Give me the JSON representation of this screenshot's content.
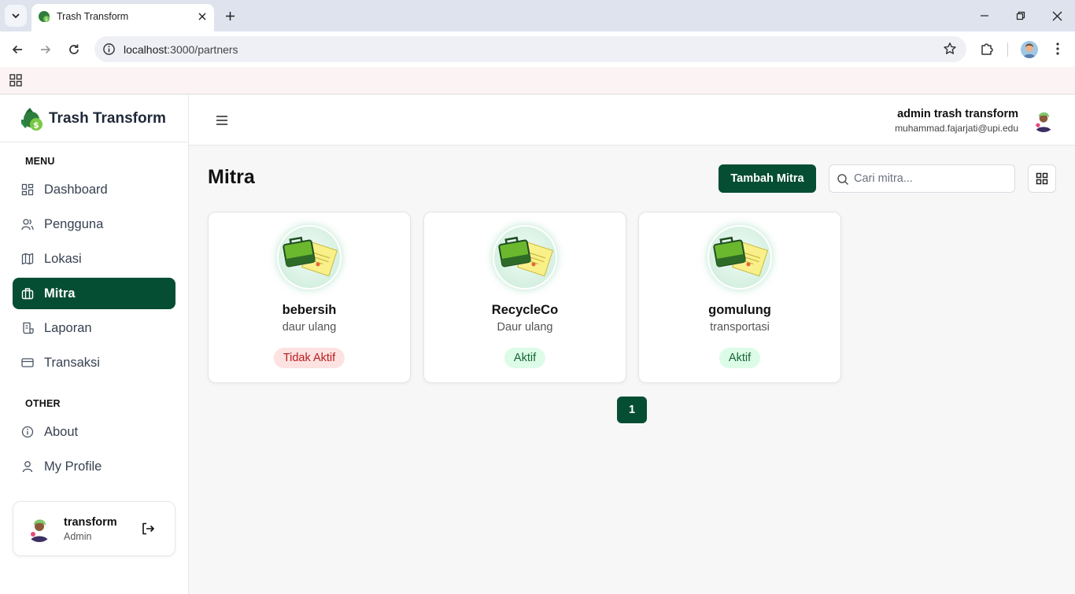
{
  "browser": {
    "tab_title": "Trash Transform",
    "url_host": "localhost",
    "url_path": ":3000/partners"
  },
  "sidebar": {
    "brand": "Trash Transform",
    "menu_label": "MENU",
    "items": [
      {
        "label": "Dashboard",
        "icon": "dashboard-icon"
      },
      {
        "label": "Pengguna",
        "icon": "users-icon"
      },
      {
        "label": "Lokasi",
        "icon": "map-icon"
      },
      {
        "label": "Mitra",
        "icon": "briefcase-icon",
        "active": true
      },
      {
        "label": "Laporan",
        "icon": "report-icon"
      },
      {
        "label": "Transaksi",
        "icon": "card-icon"
      }
    ],
    "other_label": "OTHER",
    "other_items": [
      {
        "label": "About",
        "icon": "info-icon"
      },
      {
        "label": "My Profile",
        "icon": "user-icon"
      }
    ],
    "user": {
      "name": "transform",
      "role": "Admin"
    }
  },
  "header": {
    "name": "admin trash transform",
    "email": "muhammad.fajarjati@upi.edu"
  },
  "main": {
    "title": "Mitra",
    "add_button": "Tambah Mitra",
    "search_placeholder": "Cari mitra...",
    "partners": [
      {
        "name": "bebersih",
        "type": "daur ulang",
        "status": "Tidak Aktif",
        "active": false
      },
      {
        "name": "RecycleCo",
        "type": "Daur ulang",
        "status": "Aktif",
        "active": true
      },
      {
        "name": "gomulung",
        "type": "transportasi",
        "status": "Aktif",
        "active": true
      }
    ],
    "pagination": {
      "current_page": "1"
    }
  },
  "colors": {
    "primary": "#064e33",
    "active_badge_bg": "#dcfce7",
    "inactive_badge_bg": "#fde2e2"
  }
}
